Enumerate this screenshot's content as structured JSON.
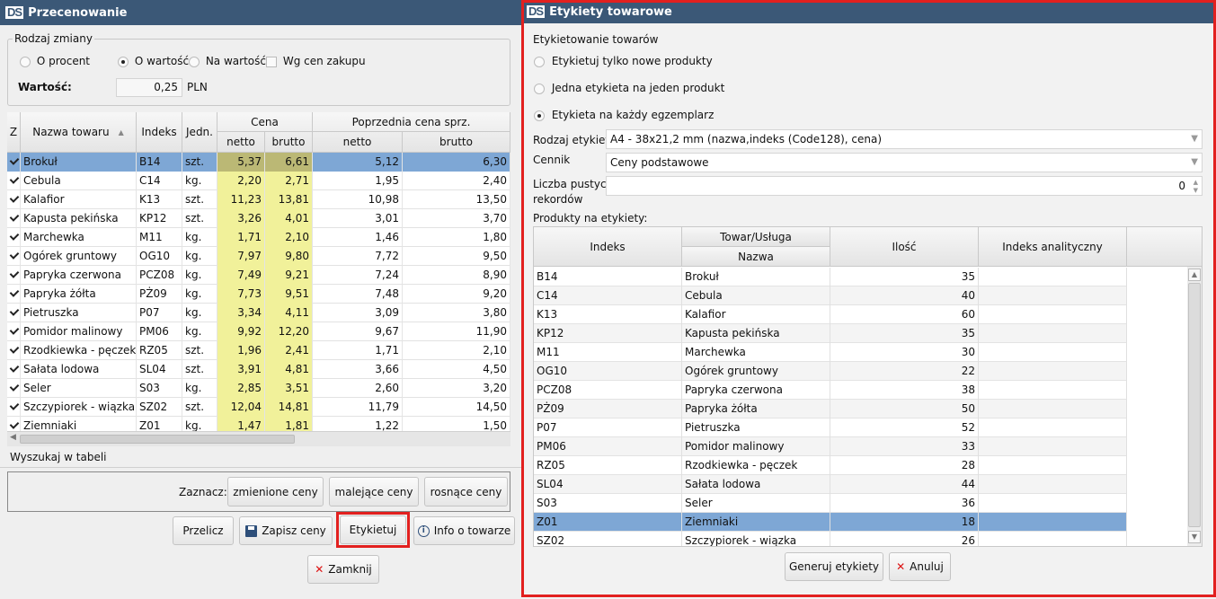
{
  "left": {
    "title": "Przecenowanie",
    "group_label": "Rodzaj zmiany",
    "radios": [
      "O procent",
      "O wartość",
      "Na wartość"
    ],
    "checkbox": "Wg cen zakupu",
    "value_label": "Wartość:",
    "value": "0,25",
    "unit": "PLN",
    "headers": {
      "z": "Z",
      "nazwa": "Nazwa towaru",
      "sort": "▲",
      "indeks": "Indeks",
      "jedn": "Jedn.",
      "cena": "Cena",
      "poprz": "Poprzednia cena sprz.",
      "netto": "netto",
      "brutto": "brutto",
      "netto2": "netto",
      "brutto2": "brutto"
    },
    "rows": [
      {
        "nazwa": "Brokuł",
        "indeks": "B14",
        "jedn": "szt.",
        "netto": "5,37",
        "brutto": "6,61",
        "pn": "5,12",
        "pb": "6,30"
      },
      {
        "nazwa": "Cebula",
        "indeks": "C14",
        "jedn": "kg.",
        "netto": "2,20",
        "brutto": "2,71",
        "pn": "1,95",
        "pb": "2,40"
      },
      {
        "nazwa": "Kalafior",
        "indeks": "K13",
        "jedn": "szt.",
        "netto": "11,23",
        "brutto": "13,81",
        "pn": "10,98",
        "pb": "13,50"
      },
      {
        "nazwa": "Kapusta pekińska",
        "indeks": "KP12",
        "jedn": "szt.",
        "netto": "3,26",
        "brutto": "4,01",
        "pn": "3,01",
        "pb": "3,70"
      },
      {
        "nazwa": "Marchewka",
        "indeks": "M11",
        "jedn": "kg.",
        "netto": "1,71",
        "brutto": "2,10",
        "pn": "1,46",
        "pb": "1,80"
      },
      {
        "nazwa": "Ogórek gruntowy",
        "indeks": "OG10",
        "jedn": "kg.",
        "netto": "7,97",
        "brutto": "9,80",
        "pn": "7,72",
        "pb": "9,50"
      },
      {
        "nazwa": "Papryka czerwona",
        "indeks": "PCZ08",
        "jedn": "kg.",
        "netto": "7,49",
        "brutto": "9,21",
        "pn": "7,24",
        "pb": "8,90"
      },
      {
        "nazwa": "Papryka żółta",
        "indeks": "PŻ09",
        "jedn": "kg.",
        "netto": "7,73",
        "brutto": "9,51",
        "pn": "7,48",
        "pb": "9,20"
      },
      {
        "nazwa": "Pietruszka",
        "indeks": "P07",
        "jedn": "kg.",
        "netto": "3,34",
        "brutto": "4,11",
        "pn": "3,09",
        "pb": "3,80"
      },
      {
        "nazwa": "Pomidor malinowy",
        "indeks": "PM06",
        "jedn": "kg.",
        "netto": "9,92",
        "brutto": "12,20",
        "pn": "9,67",
        "pb": "11,90"
      },
      {
        "nazwa": "Rzodkiewka - pęczek",
        "indeks": "RZ05",
        "jedn": "szt.",
        "netto": "1,96",
        "brutto": "2,41",
        "pn": "1,71",
        "pb": "2,10"
      },
      {
        "nazwa": "Sałata lodowa",
        "indeks": "SL04",
        "jedn": "szt.",
        "netto": "3,91",
        "brutto": "4,81",
        "pn": "3,66",
        "pb": "4,50"
      },
      {
        "nazwa": "Seler",
        "indeks": "S03",
        "jedn": "kg.",
        "netto": "2,85",
        "brutto": "3,51",
        "pn": "2,60",
        "pb": "3,20"
      },
      {
        "nazwa": "Szczypiorek - wiązka",
        "indeks": "SZ02",
        "jedn": "szt.",
        "netto": "12,04",
        "brutto": "14,81",
        "pn": "11,79",
        "pb": "14,50"
      },
      {
        "nazwa": "Ziemniaki",
        "indeks": "Z01",
        "jedn": "kg.",
        "netto": "1,47",
        "brutto": "1,81",
        "pn": "1,22",
        "pb": "1,50"
      }
    ],
    "search_label": "Wyszukaj w tabeli",
    "mark_label": "Zaznacz:",
    "mark_buttons": [
      "zmienione ceny",
      "malejące ceny",
      "rosnące ceny"
    ],
    "przelicz": "Przelicz",
    "zapisz": "Zapisz ceny",
    "etykietuj": "Etykietuj",
    "info": "Info o towarze",
    "zamknij": "Zamknij"
  },
  "right": {
    "title": "Etykiety towarowe",
    "section": "Etykietowanie towarów",
    "radios": [
      "Etykietuj tylko nowe produkty",
      "Jedna etykieta na jeden produkt",
      "Etykieta na każdy egzemplarz"
    ],
    "rodzaj_label": "Rodzaj etykiet:",
    "rodzaj_value": "A4 - 38x21,2 mm (nazwa,indeks (Code128), cena)",
    "cennik_label": "Cennik",
    "cennik_value": "Ceny podstawowe",
    "pustych_label1": "Liczba pustych",
    "pustych_label2": "rekordów",
    "pustych_value": "0",
    "produkty_label": "Produkty na etykiety:",
    "headers": {
      "indeks": "Indeks",
      "towar": "Towar/Usługa",
      "nazwa": "Nazwa",
      "ilosc": "Ilość",
      "analityczny": "Indeks analityczny"
    },
    "rows": [
      {
        "indeks": "B14",
        "nazwa": "Brokuł",
        "ilosc": "35"
      },
      {
        "indeks": "C14",
        "nazwa": "Cebula",
        "ilosc": "40"
      },
      {
        "indeks": "K13",
        "nazwa": "Kalafior",
        "ilosc": "60"
      },
      {
        "indeks": "KP12",
        "nazwa": "Kapusta pekińska",
        "ilosc": "35"
      },
      {
        "indeks": "M11",
        "nazwa": "Marchewka",
        "ilosc": "30"
      },
      {
        "indeks": "OG10",
        "nazwa": "Ogórek gruntowy",
        "ilosc": "22"
      },
      {
        "indeks": "PCZ08",
        "nazwa": "Papryka czerwona",
        "ilosc": "38"
      },
      {
        "indeks": "PŻ09",
        "nazwa": "Papryka żółta",
        "ilosc": "50"
      },
      {
        "indeks": "P07",
        "nazwa": "Pietruszka",
        "ilosc": "52"
      },
      {
        "indeks": "PM06",
        "nazwa": "Pomidor malinowy",
        "ilosc": "33"
      },
      {
        "indeks": "RZ05",
        "nazwa": "Rzodkiewka - pęczek",
        "ilosc": "28"
      },
      {
        "indeks": "SL04",
        "nazwa": "Sałata lodowa",
        "ilosc": "44"
      },
      {
        "indeks": "S03",
        "nazwa": "Seler",
        "ilosc": "36"
      },
      {
        "indeks": "Z01",
        "nazwa": "Ziemniaki",
        "ilosc": "18"
      },
      {
        "indeks": "SZ02",
        "nazwa": "Szczypiorek - wiązka",
        "ilosc": "26"
      }
    ],
    "generuj": "Generuj etykiety",
    "anuluj": "Anuluj"
  },
  "colors": {
    "title_bar": "#3b5877",
    "selection": "#7ea7d5",
    "price_highlight": "#f1f19a",
    "highlight_frame": "#e2201f"
  }
}
